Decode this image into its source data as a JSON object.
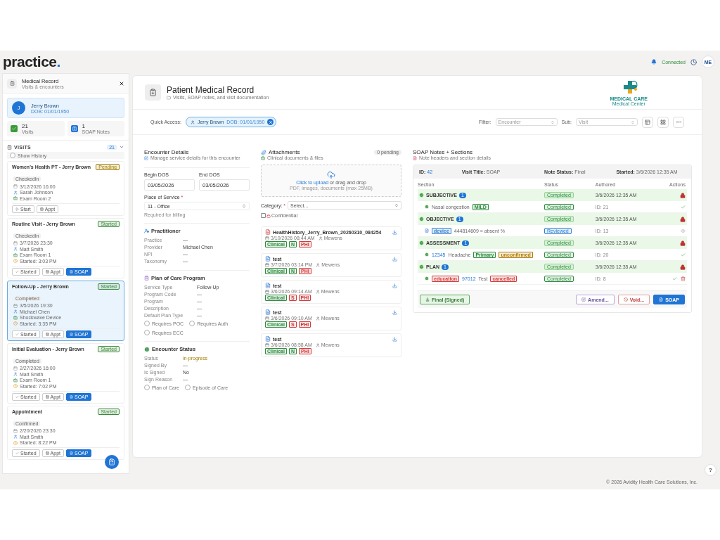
{
  "app": {
    "logo": "practice",
    "logo_dot": ".",
    "status": "Connected",
    "avatar": "ME"
  },
  "sidebar": {
    "title": "Medical Record",
    "subtitle": "Visits & encounters",
    "patient": {
      "initial": "J",
      "name": "Jerry Brown",
      "dob": "DOB: 01/01/1950"
    },
    "stats": [
      {
        "kind": "visits",
        "value": "21",
        "label": "Visits"
      },
      {
        "kind": "notes",
        "value": "1",
        "label": "SOAP Notes"
      }
    ],
    "visits_header": {
      "title": "VISITS",
      "count": "21",
      "expanded": true
    },
    "show_history": {
      "label": "Show History",
      "checked": false
    },
    "visits": [
      {
        "title": "Women's Health PT - Jerry Brown",
        "status": "Pending",
        "color": "#a27c00",
        "state": "CheckedIn",
        "selected": false,
        "info": [
          {
            "kind": "date",
            "text": "3/12/2026 16:00"
          },
          {
            "kind": "person",
            "text": "Sarah Johnson"
          },
          {
            "kind": "room",
            "text": "Exam Room 2"
          }
        ],
        "buttons": [
          {
            "kind": "start",
            "label": "Start"
          },
          {
            "kind": "appt",
            "label": "Appt"
          }
        ]
      },
      {
        "title": "Routine Visit - Jerry Brown",
        "status": "Started",
        "color": "#3a8a3a",
        "state": "CheckedIn",
        "selected": false,
        "info": [
          {
            "kind": "date",
            "text": "3/7/2026 23:30"
          },
          {
            "kind": "person",
            "text": "Matt Smith"
          },
          {
            "kind": "room",
            "text": "Exam Room 1"
          },
          {
            "kind": "time",
            "text": "Started: 3:03 PM"
          }
        ],
        "buttons": [
          {
            "kind": "started",
            "label": "Started"
          },
          {
            "kind": "appt",
            "label": "Appt"
          },
          {
            "kind": "soap",
            "label": "SOAP"
          }
        ]
      },
      {
        "title": "Follow-Up - Jerry Brown",
        "status": "Started",
        "color": "#3a8a3a",
        "state": "Completed",
        "selected": true,
        "info": [
          {
            "kind": "date",
            "text": "3/5/2026 19:30"
          },
          {
            "kind": "person",
            "text": "Michael Chen"
          },
          {
            "kind": "room",
            "text": "Shockwave Device"
          },
          {
            "kind": "time",
            "text": "Started: 3:35 PM"
          }
        ],
        "buttons": [
          {
            "kind": "started",
            "label": "Started"
          },
          {
            "kind": "appt",
            "label": "Appt"
          },
          {
            "kind": "soap",
            "label": "SOAP"
          }
        ]
      },
      {
        "title": "Initial Evaluation - Jerry Brown",
        "status": "Started",
        "color": "#3a8a3a",
        "state": "Completed",
        "selected": false,
        "info": [
          {
            "kind": "date",
            "text": "2/27/2026 16:00"
          },
          {
            "kind": "person",
            "text": "Matt Smith"
          },
          {
            "kind": "room",
            "text": "Exam Room 1"
          },
          {
            "kind": "time",
            "text": "Started: 7:02 PM"
          }
        ],
        "buttons": [
          {
            "kind": "started",
            "label": "Started"
          },
          {
            "kind": "appt",
            "label": "Appt"
          },
          {
            "kind": "soap",
            "label": "SOAP"
          }
        ]
      },
      {
        "title": "Appointment",
        "status": "Started",
        "color": "#3a8a3a",
        "state": "Confirmed",
        "selected": false,
        "info": [
          {
            "kind": "date",
            "text": "2/20/2026 23:30"
          },
          {
            "kind": "person",
            "text": "Matt Smith"
          },
          {
            "kind": "time",
            "text": "Started: 8:22 PM"
          }
        ],
        "buttons": [
          {
            "kind": "started",
            "label": "Started"
          },
          {
            "kind": "appt",
            "label": "Appt"
          },
          {
            "kind": "soap",
            "label": "SOAP"
          }
        ]
      }
    ]
  },
  "header": {
    "title": "Patient Medical Record",
    "subtitle": "Visits, SOAP notes, and visit documentation",
    "brand": "MEDICAL CARE",
    "brand_sub": "Medical Center"
  },
  "quick_access": {
    "label": "Quick Access:",
    "name": "Jerry Brown",
    "dob": "DOB: 01/01/1950",
    "filter_label": "Filter:",
    "filter": "Encounter",
    "sub_label": "Sub:",
    "sub": "Visit"
  },
  "encounter": {
    "title": "Encounter Details",
    "subtitle": "Manage service details for this encounter",
    "begin_label": "Begin DOS",
    "begin": "03/05/2026",
    "end_label": "End DOS",
    "end": "03/05/2026",
    "place_label": "Place of Service",
    "place_required": "*",
    "place": "11 - Office",
    "place_hint": "Required for billing",
    "practitioner": {
      "title": "Practitioner",
      "rows": [
        {
          "label": "Practice",
          "value": "—"
        },
        {
          "label": "Provider",
          "value": "Michael Chen"
        },
        {
          "label": "NPI",
          "value": "—"
        },
        {
          "label": "Taxonomy",
          "value": "—"
        }
      ]
    },
    "plan": {
      "title": "Plan of Care Program",
      "rows": [
        {
          "label": "Service Type",
          "value": "Follow-Up"
        },
        {
          "label": "Program Code",
          "value": "—"
        },
        {
          "label": "Program",
          "value": "—"
        },
        {
          "label": "Description",
          "value": "—"
        },
        {
          "label": "Default Plan Type",
          "value": "—"
        }
      ],
      "options": [
        {
          "label": "Requires POC",
          "checked": false
        },
        {
          "label": "Requires Auth",
          "checked": false
        },
        {
          "label": "Requires ECC",
          "checked": false
        }
      ]
    },
    "status": {
      "title": "Encounter Status",
      "rows": [
        {
          "label": "Status",
          "value": "in-progress",
          "kind": "status"
        },
        {
          "label": "Signed By",
          "value": "—",
          "kind": "plain"
        },
        {
          "label": "Is Signed",
          "value": "No",
          "kind": "plain"
        },
        {
          "label": "Sign Reason",
          "value": "—",
          "kind": "plain"
        }
      ],
      "options": [
        {
          "label": "Plan of Care",
          "checked": false
        },
        {
          "label": "Episode of Care",
          "checked": false
        }
      ]
    }
  },
  "attachments": {
    "title": "Attachments",
    "subtitle": "Clinical documents & files",
    "pending": "0 pending",
    "upload_link": "Click to upload",
    "upload_rest": "or drag and drop",
    "upload_hint": "PDF, images, documents (max 25MB)",
    "category_label": "Category:",
    "category_required": "*",
    "category": "Select...",
    "confidential": {
      "label": "Confidential",
      "checked": false
    },
    "files": [
      {
        "kind": "pdf",
        "name": "HealthHistory_Jerry_Brown_20260310_084254",
        "date": "3/10/2026 08:44 AM",
        "user": "Mewens",
        "tags": [
          {
            "text": "Clinical",
            "color": "#2e8b3e"
          },
          {
            "text": "N",
            "color": "#2e8b3e"
          },
          {
            "text": "PHI",
            "color": "#d03a3a"
          }
        ]
      },
      {
        "kind": "doc",
        "name": "test",
        "date": "3/7/2026 03:14 PM",
        "user": "Mewens",
        "tags": [
          {
            "text": "Clinical",
            "color": "#2e8b3e"
          },
          {
            "text": "N",
            "color": "#2e8b3e"
          },
          {
            "text": "PHI",
            "color": "#d03a3a"
          }
        ]
      },
      {
        "kind": "doc",
        "name": "test",
        "date": "3/6/2026 09:14 AM",
        "user": "Mewens",
        "tags": [
          {
            "text": "Clinical",
            "color": "#2e8b3e"
          },
          {
            "text": "S",
            "color": "#d03a3a"
          },
          {
            "text": "PHI",
            "color": "#d03a3a"
          }
        ]
      },
      {
        "kind": "doc",
        "name": "test",
        "date": "3/6/2026 09:10 AM",
        "user": "Mewens",
        "tags": [
          {
            "text": "Clinical",
            "color": "#2e8b3e"
          },
          {
            "text": "S",
            "color": "#d03a3a"
          },
          {
            "text": "PHI",
            "color": "#d03a3a"
          }
        ]
      },
      {
        "kind": "doc",
        "name": "test",
        "date": "3/6/2026 08:58 AM",
        "user": "Mewens",
        "tags": [
          {
            "text": "Clinical",
            "color": "#2e8b3e"
          },
          {
            "text": "N",
            "color": "#2e8b3e"
          },
          {
            "text": "PHI",
            "color": "#d03a3a"
          }
        ]
      }
    ]
  },
  "soap": {
    "title": "SOAP Notes + Sections",
    "subtitle": "Note headers and section details",
    "meta": [
      {
        "label": "ID:",
        "value": "42",
        "kind": "link"
      },
      {
        "label": "Visit Title:",
        "value": "SOAP",
        "kind": "plain"
      },
      {
        "label": "Note Status:",
        "value": "Final",
        "kind": "plain"
      },
      {
        "label": "Started:",
        "value": "3/6/2026 12:35 AM",
        "kind": "plain"
      }
    ],
    "columns": [
      "Section",
      "Status",
      "Authored",
      "Actions"
    ],
    "sections": [
      {
        "name": "SUBJECTIVE",
        "count": "1",
        "status": "Completed",
        "authored": "3/6/2026 12:35 AM",
        "locked": true,
        "items": [
          {
            "kind": "finding",
            "parts": [
              {
                "kind": "text",
                "text": "Nasal congestion"
              },
              {
                "kind": "tag",
                "text": "MILD",
                "color": "#2e8b3e"
              }
            ],
            "status": {
              "text": "Completed",
              "color": "#2e8b3e"
            },
            "id": "ID: 21",
            "deletable": false
          }
        ]
      },
      {
        "name": "OBJECTIVE",
        "count": "1",
        "status": "Completed",
        "authored": "3/6/2026 12:35 AM",
        "locked": true,
        "items": [
          {
            "kind": "observation",
            "parts": [
              {
                "kind": "tag",
                "text": "device",
                "color": "#2f7fd0"
              },
              {
                "kind": "text",
                "text": "444814609 = absent %"
              }
            ],
            "status": {
              "text": "Reviewed",
              "color": "#2f7fd0"
            },
            "id": "ID: 13",
            "deletable": false
          }
        ]
      },
      {
        "name": "ASSESSMENT",
        "count": "1",
        "status": "Completed",
        "authored": "3/6/2026 12:35 AM",
        "locked": true,
        "items": [
          {
            "kind": "finding",
            "parts": [
              {
                "kind": "code",
                "text": "12345"
              },
              {
                "kind": "text",
                "text": "Headache"
              },
              {
                "kind": "tag",
                "text": "Primary",
                "color": "#2e8b3e"
              },
              {
                "kind": "tag",
                "text": "unconfirmed",
                "color": "#b07a00"
              }
            ],
            "status": {
              "text": "Completed",
              "color": "#2e8b3e"
            },
            "id": "ID: 20",
            "deletable": false
          }
        ]
      },
      {
        "name": "PLAN",
        "count": "1",
        "status": "Completed",
        "authored": "3/6/2026 12:35 AM",
        "locked": true,
        "items": [
          {
            "kind": "finding",
            "parts": [
              {
                "kind": "tag",
                "text": "education",
                "color": "#d03a3a"
              },
              {
                "kind": "code",
                "text": "97012"
              },
              {
                "kind": "text",
                "text": "Test"
              },
              {
                "kind": "tag",
                "text": "cancelled",
                "color": "#d03a3a"
              }
            ],
            "status": {
              "text": "Completed",
              "color": "#2e8b3e"
            },
            "id": "ID: 8",
            "deletable": true
          }
        ]
      }
    ],
    "buttons": [
      {
        "kind": "final",
        "label": "Final (Signed)"
      },
      {
        "kind": "amend",
        "label": "Amend..."
      },
      {
        "kind": "void",
        "label": "Void..."
      },
      {
        "kind": "soap",
        "label": "SOAP"
      }
    ]
  },
  "footer": {
    "copyright": "© 2026 Avidity Health Care Solutions, Inc.",
    "help": "?"
  }
}
